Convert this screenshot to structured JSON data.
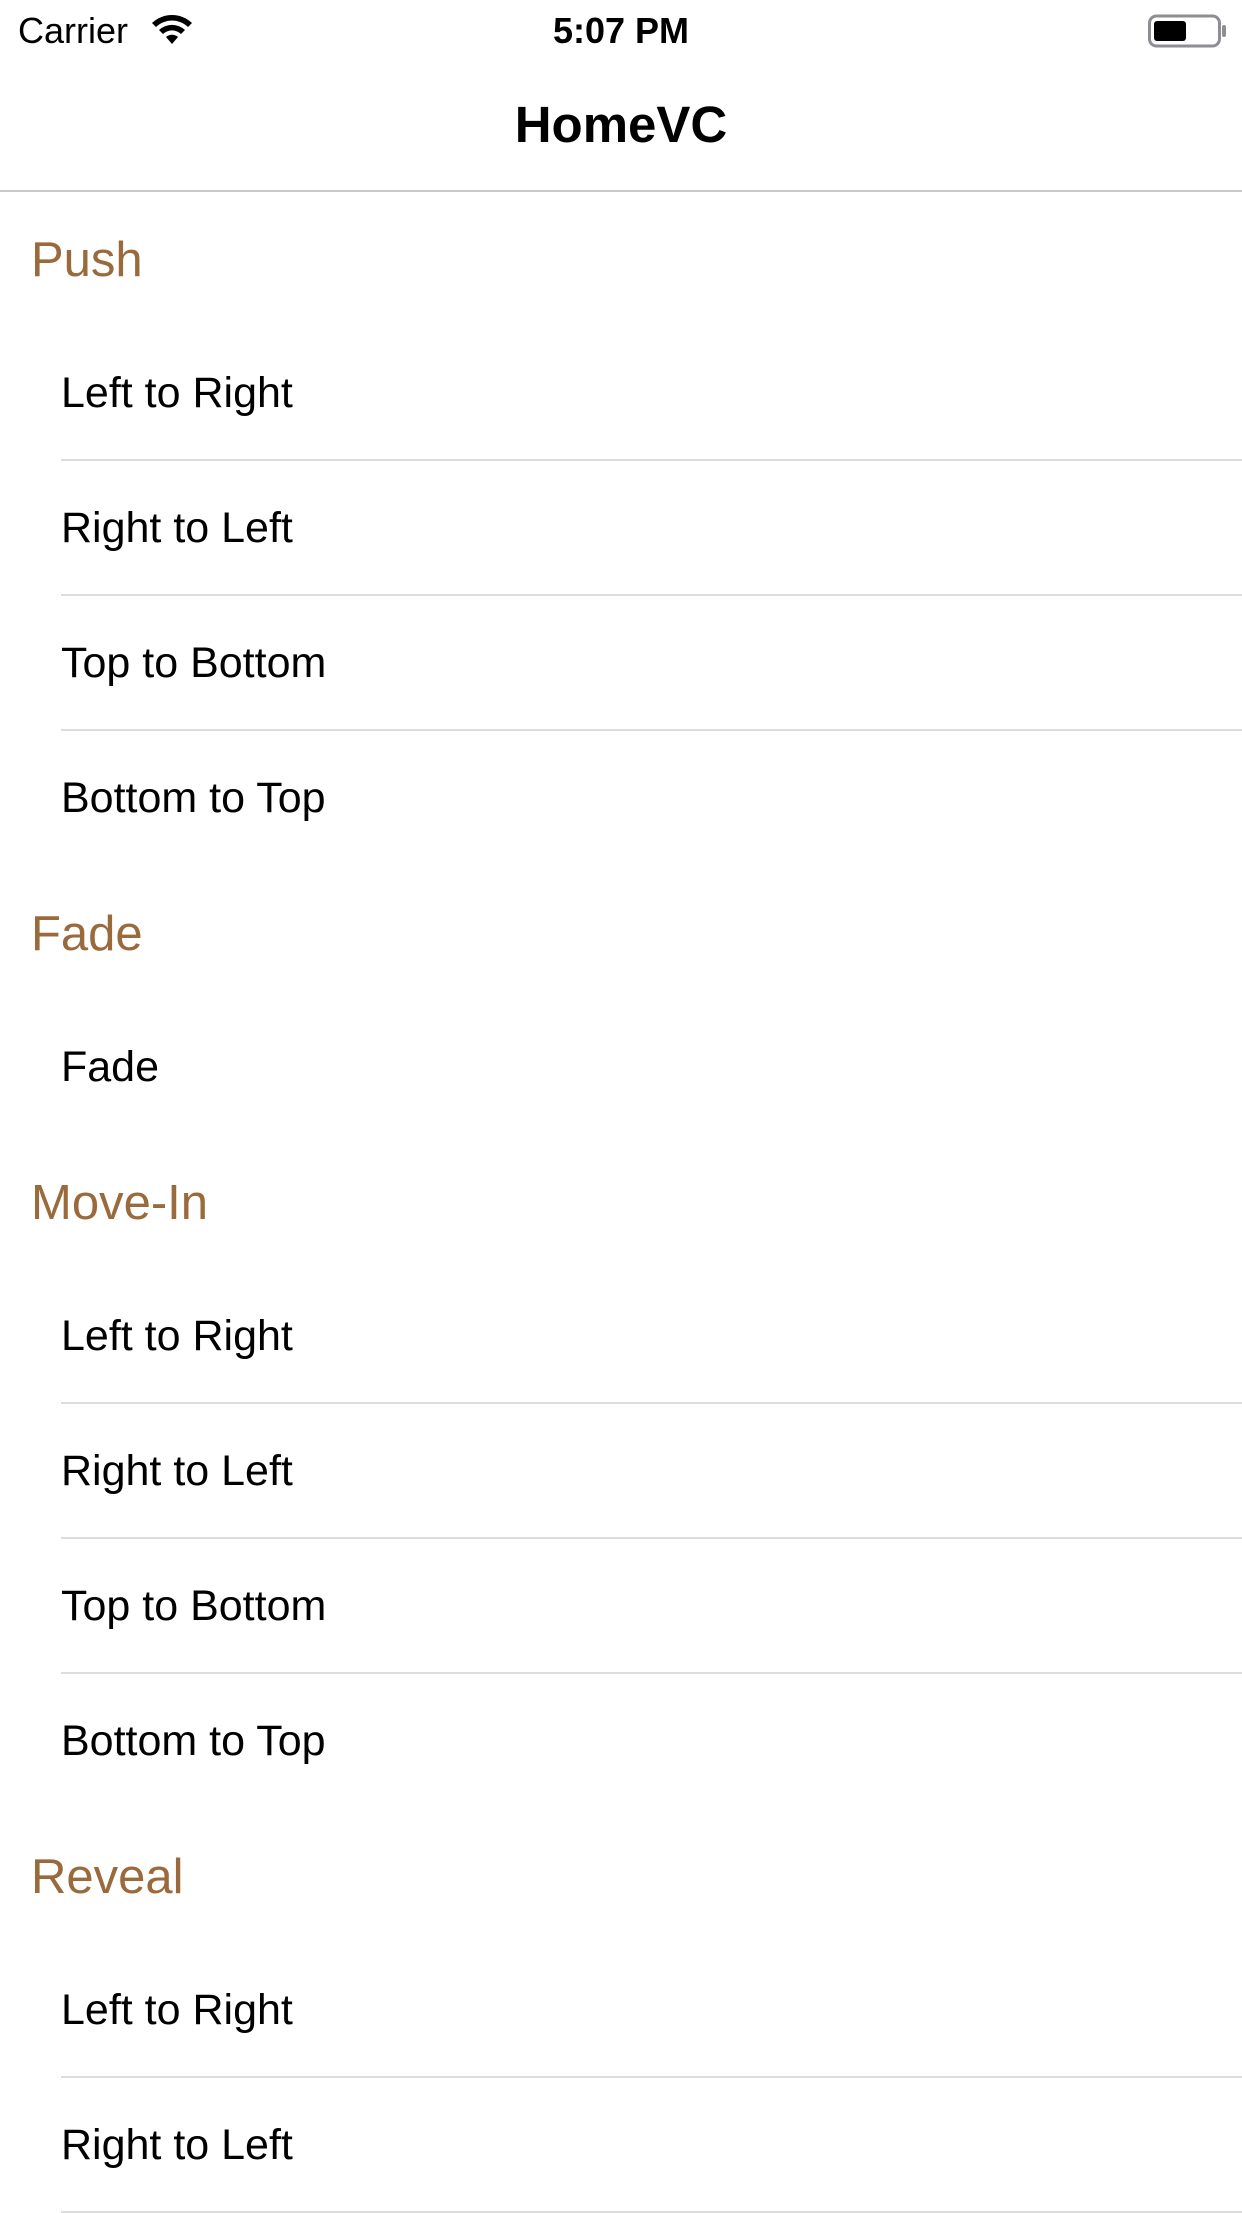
{
  "status_bar": {
    "carrier": "Carrier",
    "time": "5:07 PM",
    "wifi_icon": "wifi-icon",
    "battery_icon": "battery-icon"
  },
  "nav": {
    "title": "HomeVC"
  },
  "colors": {
    "section_header": "#9a6a3c",
    "separator": "#dcdcdc",
    "text": "#000000"
  },
  "sections": [
    {
      "title": "Push",
      "rows": [
        "Left to Right",
        "Right to Left",
        "Top to Bottom",
        "Bottom to Top"
      ]
    },
    {
      "title": "Fade",
      "rows": [
        "Fade"
      ]
    },
    {
      "title": "Move-In",
      "rows": [
        "Left to Right",
        "Right to Left",
        "Top to Bottom",
        "Bottom to Top"
      ]
    },
    {
      "title": "Reveal",
      "rows": [
        "Left to Right",
        "Right to Left"
      ]
    }
  ]
}
